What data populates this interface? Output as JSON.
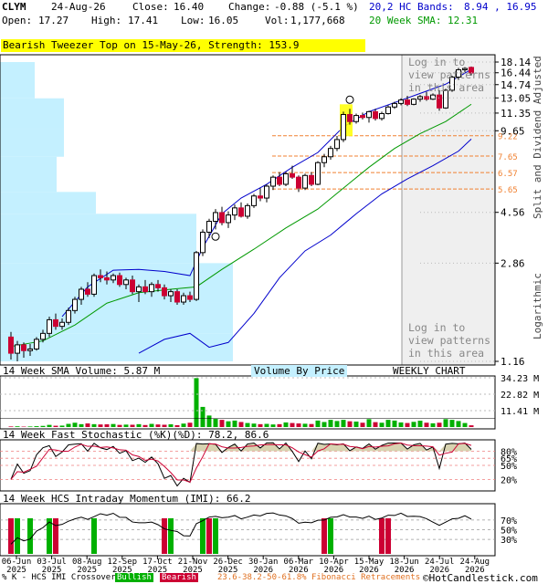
{
  "header": {
    "symbol": "CLYM",
    "date": "24-Aug-26",
    "close_label": "Close:",
    "close": "16.40",
    "change_label": "Change:",
    "change": "-0.88 (-5.1 %)",
    "open_label": "Open:",
    "open": "17.27",
    "high_label": "High:",
    "high": "17.41",
    "low_label": "Low:",
    "low": "16.05",
    "vol_label": "Vol:",
    "vol": "1,177,668",
    "bands_label": "20,2 HC Bands:",
    "bands": "8.94 , 16.95",
    "sma_label": "20 Week SMA:",
    "sma": "12.31"
  },
  "pattern_banner": "Bearish Tweezer Top on 15-May-26, Strength: 153.9",
  "login_text": [
    "Log in to",
    "view patterns",
    "in this area"
  ],
  "side_label_top": "Split and Dividend Adjusted",
  "side_label_bottom": "Logarithmic",
  "colors": {
    "up": "#00b000",
    "down": "#cc0033",
    "sma": "#009900",
    "bands": "#0000cc",
    "vbp": "#c4f0ff",
    "fib": "#f08030"
  },
  "price_axis": {
    "ticks": [
      "18.14",
      "16.44",
      "14.74",
      "13.05",
      "11.35",
      "9.65",
      "4.56",
      "2.86",
      "1.16"
    ],
    "fib_labels": [
      "9.22",
      "7.65",
      "6.57",
      "5.65"
    ]
  },
  "volume_panel": {
    "title": "14 Week SMA Volume: 5.87 M",
    "vbp_label": "Volume By Price",
    "chart_label": "WEEKLY CHART",
    "ticks": [
      "34.23 M",
      "22.82 M",
      "11.41 M"
    ]
  },
  "stoch_panel": {
    "title": "14 Week Fast Stochastic (%K)(%D): 78.2, 86.6",
    "ticks": [
      "80%",
      "65%",
      "50%",
      "20%"
    ]
  },
  "imi_panel": {
    "title": "14 Week HCS Intraday Momentum (IMI): 66.2",
    "ticks": [
      "70%",
      "50%",
      "30%"
    ]
  },
  "x_axis": [
    "06-Jun 2025",
    "03-Jul 2025",
    "08-Aug 2025",
    "12-Sep 2025",
    "17-Oct 2025",
    "21-Nov 2025",
    "26-Dec 2025",
    "30-Jan 2026",
    "06-Mar 2026",
    "10-Apr 2026",
    "15-May 2026",
    "18-Jun 2026",
    "24-Jul 2026",
    "24-Aug 2026"
  ],
  "footer": {
    "legend_prefix": "% K - HCS IMI Crossover:",
    "bullish": "Bullish",
    "bearish": "Bearish",
    "fib": "23.6-38.2-50-61.8% Fibonacci Retracements",
    "copyright": "©HotCandlestick.com"
  },
  "chart_data": {
    "type": "candlestick",
    "title": "CLYM",
    "scale": "logarithmic",
    "ylim": [
      1.16,
      18.14
    ],
    "candles": [
      [
        1.45,
        1.52,
        1.18,
        1.25
      ],
      [
        1.25,
        1.4,
        1.16,
        1.35
      ],
      [
        1.35,
        1.38,
        1.2,
        1.28
      ],
      [
        1.28,
        1.36,
        1.22,
        1.3
      ],
      [
        1.3,
        1.45,
        1.28,
        1.42
      ],
      [
        1.42,
        1.55,
        1.38,
        1.5
      ],
      [
        1.5,
        1.75,
        1.45,
        1.7
      ],
      [
        1.7,
        1.8,
        1.55,
        1.6
      ],
      [
        1.6,
        1.72,
        1.55,
        1.66
      ],
      [
        1.66,
        1.9,
        1.62,
        1.85
      ],
      [
        1.85,
        2.1,
        1.8,
        2.05
      ],
      [
        2.05,
        2.3,
        1.95,
        2.25
      ],
      [
        2.25,
        2.4,
        2.1,
        2.15
      ],
      [
        2.15,
        2.6,
        2.1,
        2.55
      ],
      [
        2.55,
        2.7,
        2.4,
        2.5
      ],
      [
        2.5,
        2.65,
        2.35,
        2.45
      ],
      [
        2.45,
        2.6,
        2.38,
        2.55
      ],
      [
        2.55,
        2.62,
        2.3,
        2.35
      ],
      [
        2.35,
        2.5,
        2.25,
        2.45
      ],
      [
        2.45,
        2.55,
        2.15,
        2.2
      ],
      [
        2.2,
        2.35,
        2.0,
        2.3
      ],
      [
        2.3,
        2.45,
        2.15,
        2.2
      ],
      [
        2.2,
        2.4,
        2.1,
        2.35
      ],
      [
        2.35,
        2.45,
        2.2,
        2.28
      ],
      [
        2.28,
        2.35,
        2.05,
        2.12
      ],
      [
        2.12,
        2.25,
        2.0,
        2.2
      ],
      [
        2.2,
        2.25,
        1.95,
        2.0
      ],
      [
        2.0,
        2.18,
        1.95,
        2.12
      ],
      [
        2.12,
        2.2,
        2.0,
        2.05
      ],
      [
        2.05,
        3.2,
        2.02,
        3.15
      ],
      [
        3.15,
        3.9,
        3.05,
        3.8
      ],
      [
        3.8,
        4.3,
        3.6,
        4.2
      ],
      [
        4.2,
        4.7,
        3.9,
        4.55
      ],
      [
        4.55,
        4.8,
        4.05,
        4.15
      ],
      [
        4.15,
        4.6,
        3.95,
        4.45
      ],
      [
        4.45,
        4.9,
        4.25,
        4.75
      ],
      [
        4.75,
        5.0,
        4.35,
        4.4
      ],
      [
        4.4,
        4.95,
        4.3,
        4.85
      ],
      [
        4.85,
        5.4,
        4.75,
        5.3
      ],
      [
        5.3,
        5.7,
        5.05,
        5.2
      ],
      [
        5.2,
        5.9,
        5.0,
        5.8
      ],
      [
        5.8,
        6.4,
        5.6,
        6.3
      ],
      [
        6.3,
        6.6,
        5.8,
        5.9
      ],
      [
        5.9,
        6.6,
        5.8,
        6.5
      ],
      [
        6.5,
        7.0,
        6.2,
        6.3
      ],
      [
        6.3,
        6.4,
        5.5,
        5.7
      ],
      [
        5.7,
        6.5,
        5.6,
        6.4
      ],
      [
        6.4,
        6.6,
        5.8,
        5.9
      ],
      [
        5.9,
        7.3,
        5.85,
        7.2
      ],
      [
        7.2,
        7.8,
        6.9,
        7.6
      ],
      [
        7.6,
        8.4,
        7.4,
        8.2
      ],
      [
        8.2,
        9.2,
        8.0,
        8.9
      ],
      [
        8.9,
        11.5,
        8.7,
        11.2
      ],
      [
        11.2,
        11.8,
        10.2,
        10.5
      ],
      [
        10.5,
        11.3,
        10.3,
        11.1
      ],
      [
        11.1,
        11.4,
        10.7,
        10.9
      ],
      [
        10.9,
        11.6,
        10.4,
        11.5
      ],
      [
        11.5,
        11.8,
        10.6,
        10.8
      ],
      [
        10.8,
        11.5,
        10.6,
        11.3
      ],
      [
        11.3,
        12.2,
        11.2,
        12.0
      ],
      [
        12.0,
        12.6,
        11.8,
        12.4
      ],
      [
        12.4,
        13.0,
        12.2,
        12.8
      ],
      [
        12.8,
        13.3,
        12.1,
        12.3
      ],
      [
        12.3,
        13.0,
        12.2,
        12.9
      ],
      [
        12.9,
        13.4,
        12.6,
        13.2
      ],
      [
        13.2,
        13.8,
        12.7,
        12.9
      ],
      [
        12.9,
        13.6,
        12.8,
        13.4
      ],
      [
        13.4,
        14.0,
        11.6,
        11.9
      ],
      [
        11.9,
        14.2,
        11.8,
        14.0
      ],
      [
        14.0,
        16.0,
        13.8,
        15.8
      ],
      [
        15.8,
        17.2,
        15.4,
        16.9
      ],
      [
        16.9,
        17.3,
        16.5,
        17.1
      ],
      [
        17.27,
        17.41,
        16.05,
        16.4
      ]
    ],
    "sma20": [
      [
        0,
        1.33
      ],
      [
        5,
        1.4
      ],
      [
        10,
        1.62
      ],
      [
        15,
        1.98
      ],
      [
        20,
        2.18
      ],
      [
        25,
        2.25
      ],
      [
        29,
        2.3
      ],
      [
        33,
        2.7
      ],
      [
        38,
        3.25
      ],
      [
        43,
        3.95
      ],
      [
        48,
        4.7
      ],
      [
        52,
        5.7
      ],
      [
        56,
        6.9
      ],
      [
        60,
        8.2
      ],
      [
        64,
        9.4
      ],
      [
        68,
        10.5
      ],
      [
        72,
        12.31
      ]
    ],
    "hc_bands_upper": [
      [
        8,
        1.75
      ],
      [
        12,
        2.3
      ],
      [
        16,
        2.68
      ],
      [
        20,
        2.7
      ],
      [
        24,
        2.65
      ],
      [
        28,
        2.55
      ],
      [
        30,
        3.3
      ],
      [
        33,
        4.5
      ],
      [
        36,
        5.2
      ],
      [
        40,
        5.9
      ],
      [
        44,
        6.9
      ],
      [
        48,
        7.9
      ],
      [
        52,
        10.0
      ],
      [
        56,
        11.5
      ],
      [
        60,
        12.5
      ],
      [
        64,
        13.6
      ],
      [
        68,
        14.8
      ],
      [
        72,
        16.95
      ]
    ],
    "hc_bands_lower": [
      [
        20,
        1.25
      ],
      [
        24,
        1.42
      ],
      [
        28,
        1.5
      ],
      [
        31,
        1.32
      ],
      [
        34,
        1.38
      ],
      [
        38,
        1.8
      ],
      [
        42,
        2.5
      ],
      [
        46,
        3.2
      ],
      [
        50,
        3.7
      ],
      [
        54,
        4.5
      ],
      [
        58,
        5.4
      ],
      [
        62,
        6.2
      ],
      [
        66,
        7.0
      ],
      [
        70,
        8.0
      ],
      [
        72,
        8.94
      ]
    ],
    "fibonacci_levels": [
      9.22,
      7.65,
      6.57,
      5.65
    ],
    "pattern_marker": {
      "type": "bearish_tweezer_top",
      "date": "15-May-26",
      "candle_index": 53
    },
    "weekly_volume": [
      0.4,
      0.5,
      0.3,
      0.4,
      0.6,
      0.8,
      1.5,
      0.9,
      1.0,
      2.2,
      3.0,
      2.0,
      2.5,
      2.0,
      1.8,
      1.9,
      2.1,
      1.5,
      1.7,
      1.6,
      2.0,
      1.4,
      2.2,
      1.8,
      1.6,
      1.9,
      1.3,
      2.4,
      3.0,
      34.0,
      14.0,
      8.0,
      6.0,
      5.0,
      4.0,
      4.5,
      3.5,
      2.8,
      2.4,
      2.0,
      2.2,
      1.8,
      2.0,
      3.2,
      2.8,
      2.5,
      2.3,
      2.1,
      4.5,
      3.5,
      5.0,
      4.2,
      5.0,
      4.0,
      3.8,
      3.0,
      5.5,
      3.4,
      3.0,
      5.0,
      4.5,
      3.2,
      2.8,
      3.6,
      4.4,
      3.0,
      2.6,
      3.0,
      5.5,
      5.0,
      4.2,
      2.8,
      1.2
    ],
    "volume_sma14_current": 5.87,
    "volume_ylim": [
      0,
      34.23
    ],
    "stochastic_k_current": 78.2,
    "stochastic_d_current": 86.6,
    "imi_current": 66.2,
    "crossover_signals": [
      {
        "index": 0,
        "type": "bearish"
      },
      {
        "index": 1,
        "type": "bullish"
      },
      {
        "index": 3,
        "type": "bullish"
      },
      {
        "index": 6,
        "type": "bullish"
      },
      {
        "index": 7,
        "type": "bearish"
      },
      {
        "index": 13,
        "type": "bullish"
      },
      {
        "index": 24,
        "type": "bearish"
      },
      {
        "index": 25,
        "type": "bullish"
      },
      {
        "index": 30,
        "type": "bullish"
      },
      {
        "index": 31,
        "type": "bearish"
      },
      {
        "index": 32,
        "type": "bullish"
      },
      {
        "index": 49,
        "type": "bearish"
      },
      {
        "index": 50,
        "type": "bullish"
      },
      {
        "index": 58,
        "type": "bearish"
      },
      {
        "index": 59,
        "type": "bearish"
      }
    ]
  }
}
